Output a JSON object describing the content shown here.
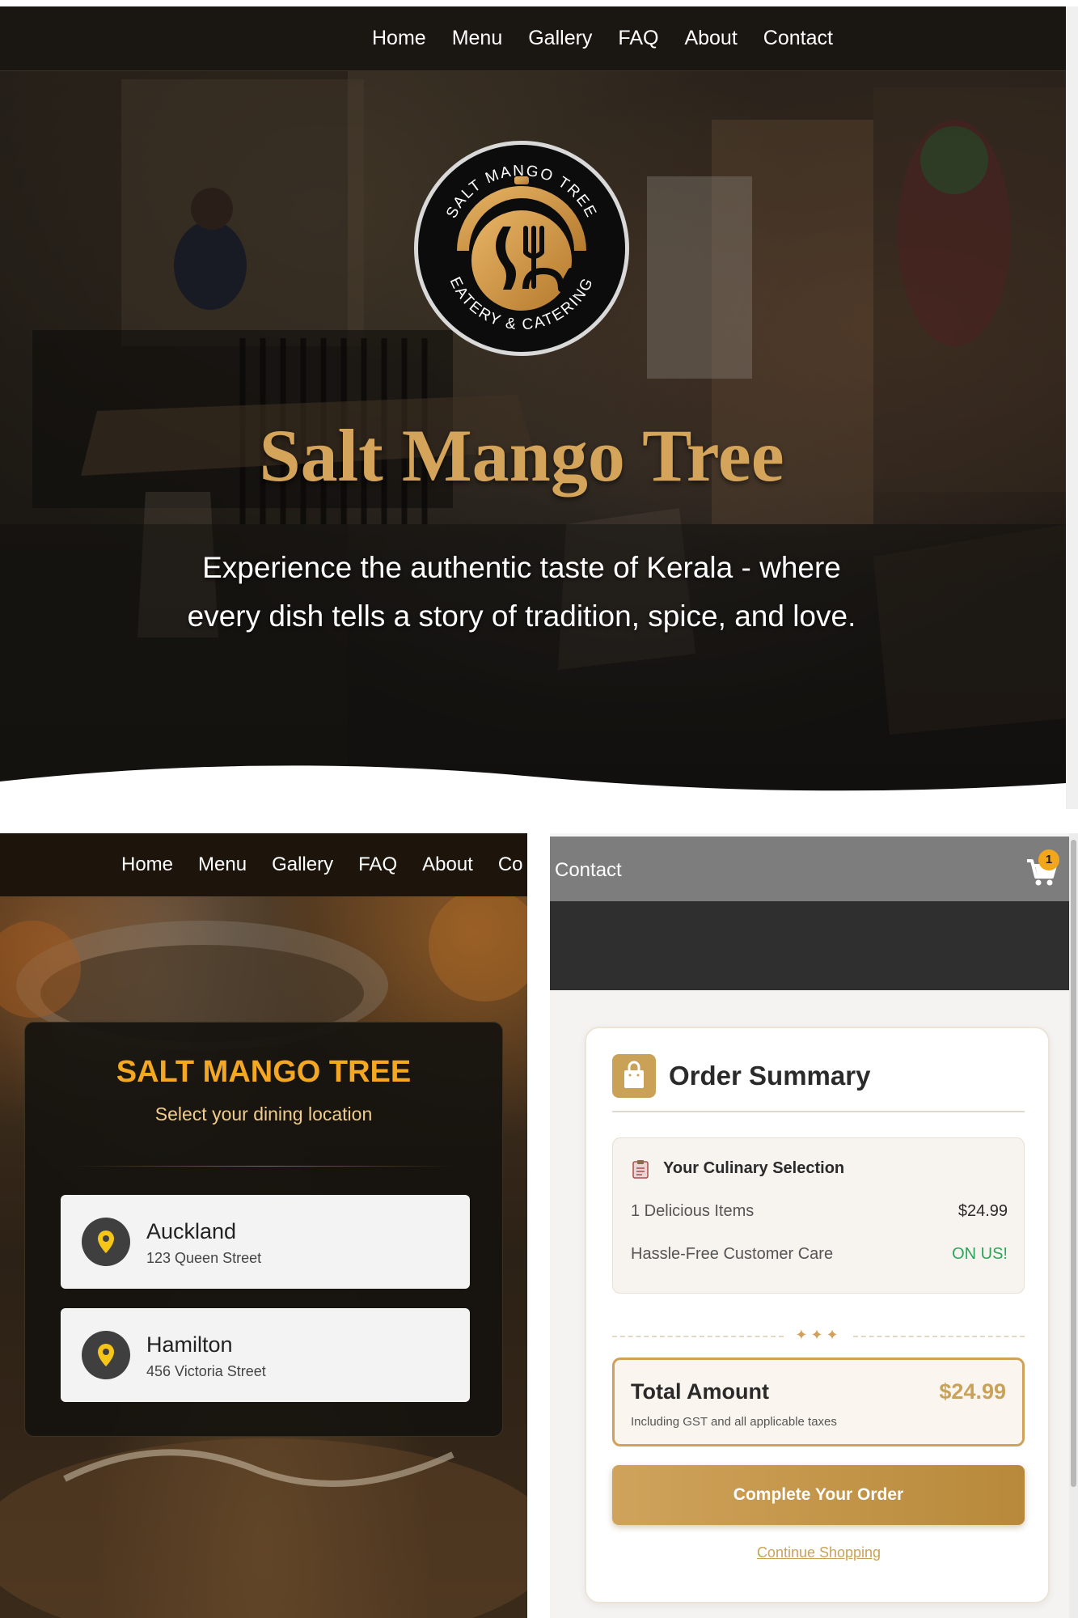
{
  "hero": {
    "nav": [
      "Home",
      "Menu",
      "Gallery",
      "FAQ",
      "About",
      "Contact"
    ],
    "logo_text_top": "SALT MANGO TREE",
    "logo_text_bottom": "EATERY & CATERING",
    "title": "Salt Mango Tree",
    "subtitle": "Experience the authentic taste of Kerala - where every dish tells a story of tradition, spice, and love."
  },
  "location_page": {
    "nav": [
      "Home",
      "Menu",
      "Gallery",
      "FAQ",
      "About",
      "Co"
    ],
    "title": "SALT MANGO TREE",
    "subtitle": "Select your dining location",
    "locations": [
      {
        "name": "Auckland",
        "address": "123 Queen Street"
      },
      {
        "name": "Hamilton",
        "address": "456 Victoria Street"
      }
    ]
  },
  "checkout_page": {
    "nav_contact": "Contact",
    "cart_count": "1",
    "order_title": "Order Summary",
    "selection_title": "Your Culinary Selection",
    "items_label": "1 Delicious Items",
    "items_price": "$24.99",
    "care_label": "Hassle-Free Customer Care",
    "care_value": "ON US!",
    "separator": "✦✦✦",
    "total_label": "Total Amount",
    "total_value": "$24.99",
    "total_note": "Including GST and all applicable taxes",
    "complete_button": "Complete Your Order",
    "continue_link": "Continue Shopping"
  },
  "colors": {
    "gold": "#d4a45a",
    "orange_title": "#f4a723",
    "badge": "#f2a71b",
    "free_green": "#2aa55a"
  }
}
